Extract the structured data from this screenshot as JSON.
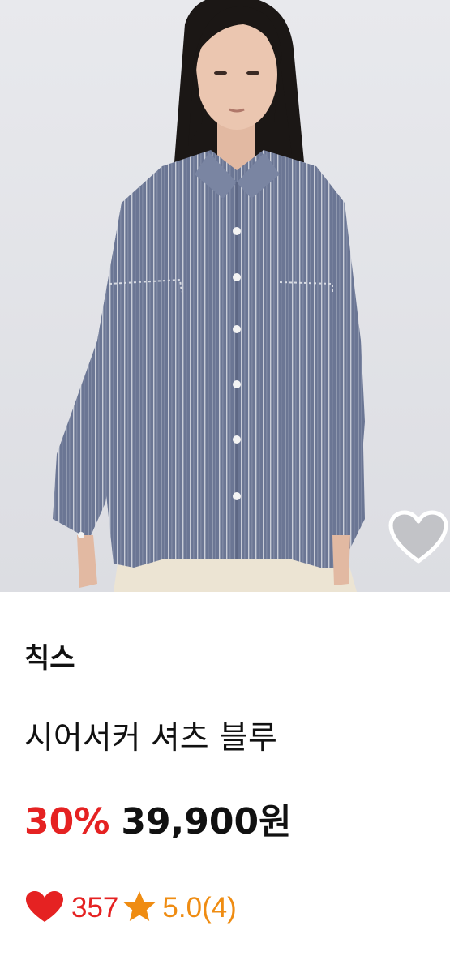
{
  "product": {
    "brand": "칙스",
    "title": "시어서커 셔츠 블루",
    "discount": "30%",
    "price": "39,900원",
    "like_count": "357",
    "rating": "5.0(4)"
  },
  "icons": {
    "wishlist": "heart-outline-icon",
    "likes": "heart-filled-icon",
    "rating": "star-icon"
  },
  "colors": {
    "discount": "#e52222",
    "like": "#e52222",
    "rating": "#ef8c12",
    "text": "#111111"
  }
}
